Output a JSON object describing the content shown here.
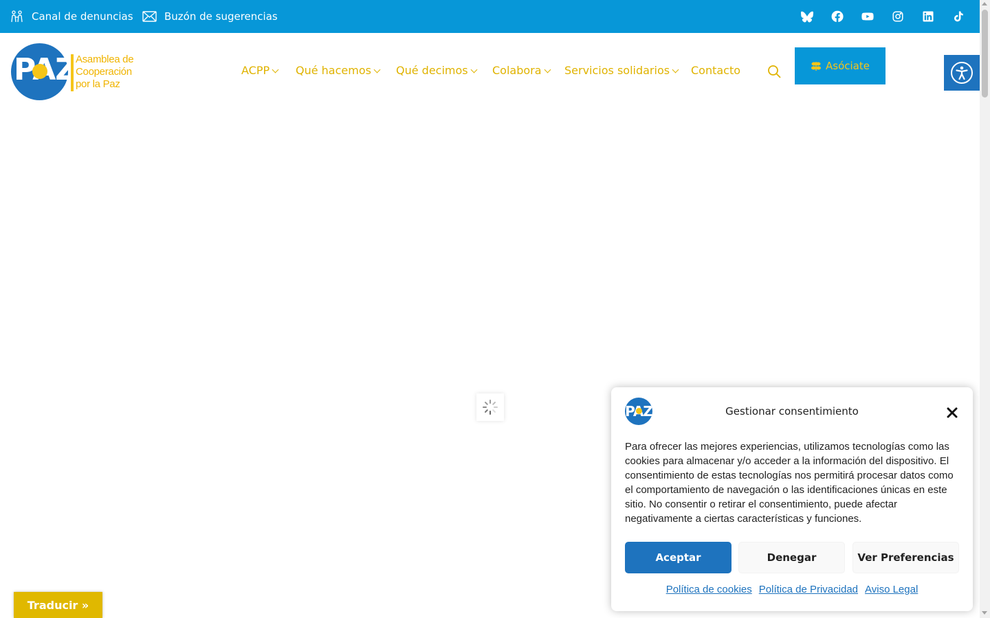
{
  "topbar": {
    "bg_color": "#0797d8",
    "links": [
      {
        "label": "Canal de denuncias",
        "icon": "people-icon"
      },
      {
        "label": "Buzón de sugerencias",
        "icon": "envelope-icon"
      }
    ],
    "social": [
      "bluesky-icon",
      "facebook-icon",
      "youtube-icon",
      "instagram-icon",
      "linkedin-icon",
      "tiktok-icon"
    ]
  },
  "header": {
    "logo": {
      "mark": "PAZ",
      "text_line1": "Asamblea de",
      "text_line2": "Cooperación",
      "text_line3": "por la Paz"
    },
    "nav": [
      {
        "label": "ACPP",
        "has_dropdown": true
      },
      {
        "label": "Qué hacemos",
        "has_dropdown": true
      },
      {
        "label": "Qué decimos",
        "has_dropdown": true
      },
      {
        "label": "Colabora",
        "has_dropdown": true
      },
      {
        "label": "Servicios solidarios",
        "has_dropdown": true
      },
      {
        "label": "Contacto",
        "has_dropdown": false
      }
    ],
    "cta": {
      "label": "Asóciate",
      "icon": "seedling-icon"
    },
    "colors": {
      "nav_text": "#e0b300",
      "brand_blue": "#1e73be",
      "brand_yellow": "#f5c518"
    }
  },
  "translate": {
    "label": "Traducir »"
  },
  "cookie": {
    "logo_mark": "PAZ",
    "title": "Gestionar consentimiento",
    "text": "Para ofrecer las mejores experiencias, utilizamos tecnologías como las cookies para almacenar y/o acceder a la información del dispositivo. El consentimiento de estas tecnologías nos permitirá procesar datos como el comportamiento de navegación o las identificaciones únicas en este sitio. No consentir o retirar el consentimiento, puede afectar negativamente a ciertas características y funciones.",
    "buttons": {
      "accept": "Aceptar",
      "deny": "Denegar",
      "prefs": "Ver Preferencias"
    },
    "links": [
      "Política de cookies",
      "Política de Privacidad",
      "Aviso Legal"
    ]
  }
}
